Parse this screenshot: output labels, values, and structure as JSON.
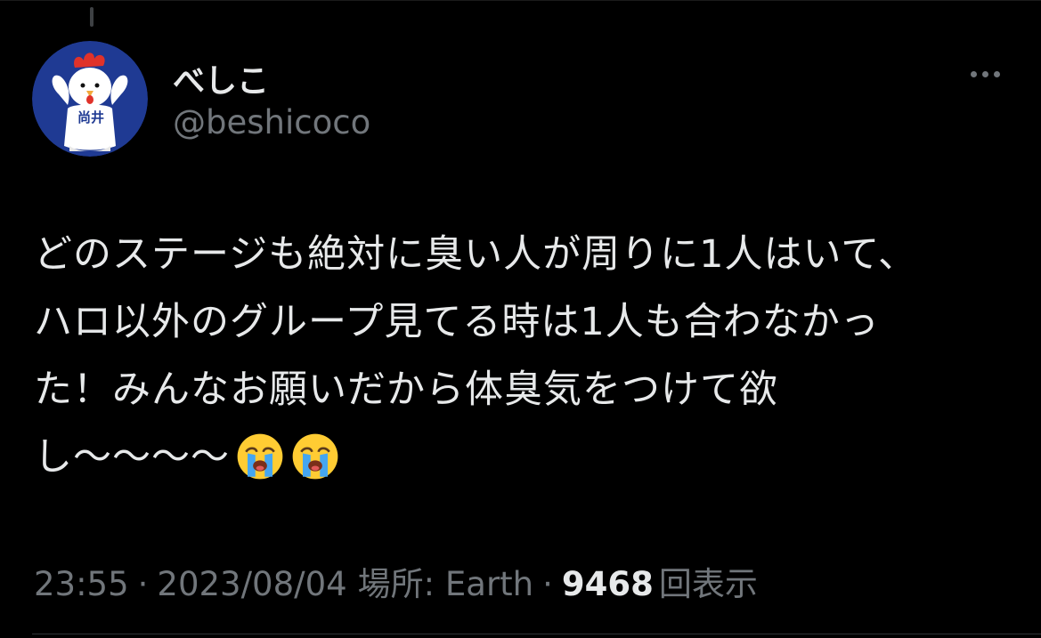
{
  "tweet": {
    "display_name": "べしこ",
    "handle": "@beshicoco",
    "text_lines": [
      "どのステージも絶対に臭い人が周りに1人はいて、",
      "ハロ以外のグループ見てる時は1人も合わなかっ",
      "た！みんなお願いだから体臭気をつけて欲",
      "し〜〜〜〜"
    ],
    "emojis": [
      "loudly-crying-face",
      "loudly-crying-face"
    ],
    "time": "23:55",
    "date": "2023/08/04",
    "location": "場所: Earth",
    "separator": "·",
    "views_count": "9468",
    "views_label": "回表示"
  },
  "avatar": {
    "icon": "chicken-mascot-avatar",
    "text": "尚井"
  },
  "icons": {
    "more": "more-horizontal-icon"
  },
  "colors": {
    "background": "#000000",
    "primary_text": "#e7e9ea",
    "secondary_text": "#71767b",
    "avatar_bg": "#1f3a93"
  }
}
